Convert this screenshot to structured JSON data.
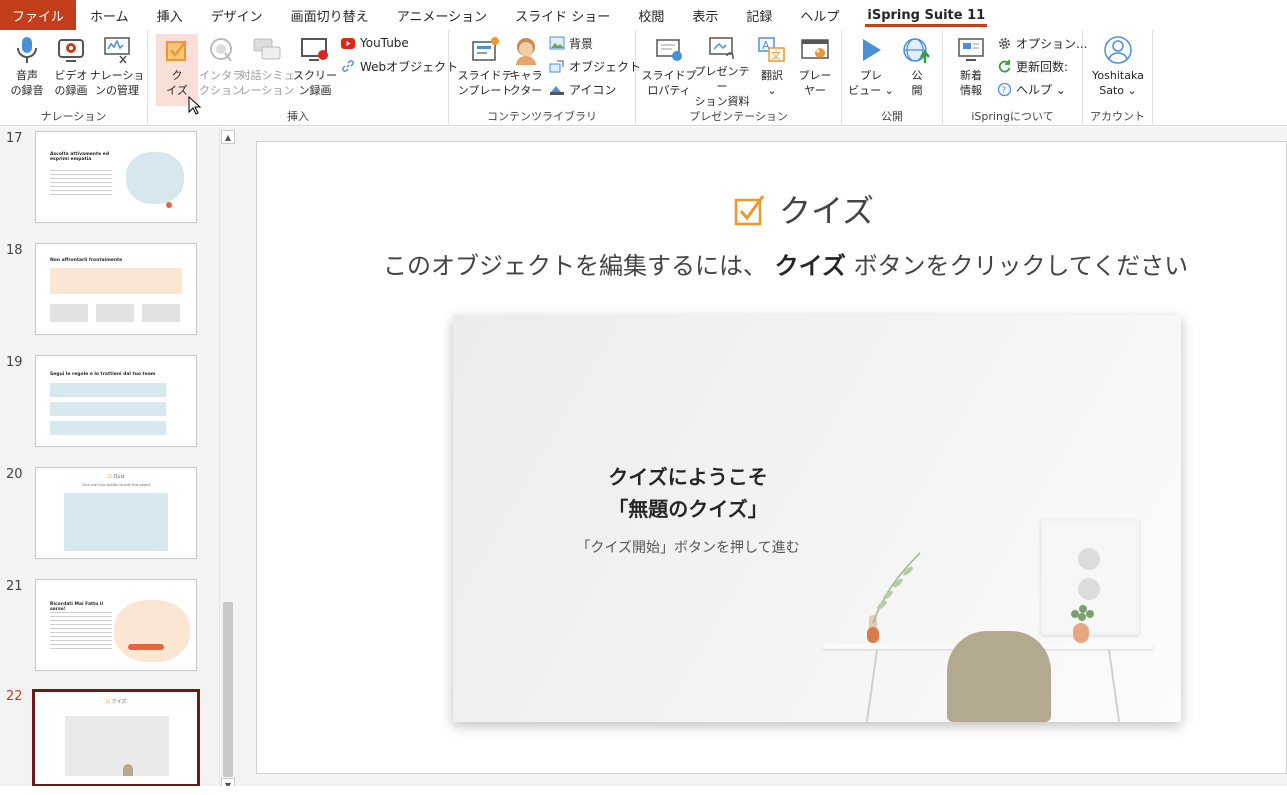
{
  "tabs": [
    "ファイル",
    "ホーム",
    "挿入",
    "デザイン",
    "画面切り替え",
    "アニメーション",
    "スライド ショー",
    "校閲",
    "表示",
    "記録",
    "ヘルプ",
    "iSpring Suite 11"
  ],
  "ribbon": {
    "narration": {
      "label": "ナレーション",
      "buttons": [
        {
          "line1": "音声",
          "line2": "の録音",
          "icon": "microphone-icon"
        },
        {
          "line1": "ビデオ",
          "line2": "の録画",
          "icon": "webcam-icon"
        },
        {
          "line1": "ナレーショ",
          "line2": "ンの管理",
          "icon": "narration-manage-icon"
        }
      ]
    },
    "insert": {
      "label": "挿入",
      "quiz": {
        "line1": "ク",
        "line2": "イズ"
      },
      "interaction": {
        "line1": "インタラ",
        "line2": "クション"
      },
      "dialog": {
        "line1": "対話シミュ",
        "line2": "レーション"
      },
      "screen": {
        "line1": "スクリー",
        "line2": "ン録画"
      },
      "youtube": "YouTube",
      "webobject": "Webオブジェクト"
    },
    "library": {
      "label": "コンテンツライブラリ",
      "template": {
        "line1": "スライドテ",
        "line2": "ンプレート"
      },
      "character": {
        "line1": "キャラ",
        "line2": "クター"
      },
      "background": "背景",
      "object": "オブジェクト",
      "icon": "アイコン"
    },
    "presentation": {
      "label": "プレゼンテーション",
      "properties": {
        "line1": "スライドプ",
        "line2": "ロパティ"
      },
      "resources": {
        "line1": "プレゼンテー",
        "line2": "ション資料"
      },
      "translate": {
        "line1": "翻訳",
        "line2": "⌄"
      },
      "player": {
        "line1": "プレー",
        "line2": "ヤー"
      }
    },
    "publish": {
      "label": "公開",
      "preview": {
        "line1": "プレ",
        "line2": "ビュー ⌄"
      },
      "publish": {
        "line1": "公",
        "line2": "開"
      }
    },
    "about": {
      "label": "iSpringについて",
      "news": {
        "line1": "新着",
        "line2": "情報"
      },
      "options": "オプション...",
      "updates": "更新回数:",
      "help": "ヘルプ ⌄"
    },
    "account": {
      "label": "アカウント",
      "name1": "Yoshitaka",
      "name2": "Sato ⌄"
    }
  },
  "slides": [
    {
      "num": "17",
      "title": "Ascolta attivamente ed esprimi empatia"
    },
    {
      "num": "18",
      "title": "Non affrontarli frontalmente"
    },
    {
      "num": "19",
      "title": "Segui le regole e lo trattieni dal tuo team"
    },
    {
      "num": "20",
      "title": "Quiz",
      "subtitle": "Click the Quiz button to edit this object"
    },
    {
      "num": "21",
      "title": "Ricordati Mai Fatto il sorso!"
    },
    {
      "num": "22",
      "title": "クイズ"
    }
  ],
  "main": {
    "quiz_title": "クイズ",
    "instruction_pre": "このオブジェクトを編集するには、",
    "instruction_bold": "クイズ",
    "instruction_post": "ボタンをクリックしてください",
    "welcome1": "クイズにようこそ",
    "welcome2": "「無題のクイズ」",
    "hint": "「クイズ開始」ボタンを押して進む"
  },
  "colors": {
    "accent": "#c43e1c",
    "quiz_orange": "#f0962e",
    "panel_bg": "#f3f3f3",
    "selected_border": "#6b1a1a"
  }
}
